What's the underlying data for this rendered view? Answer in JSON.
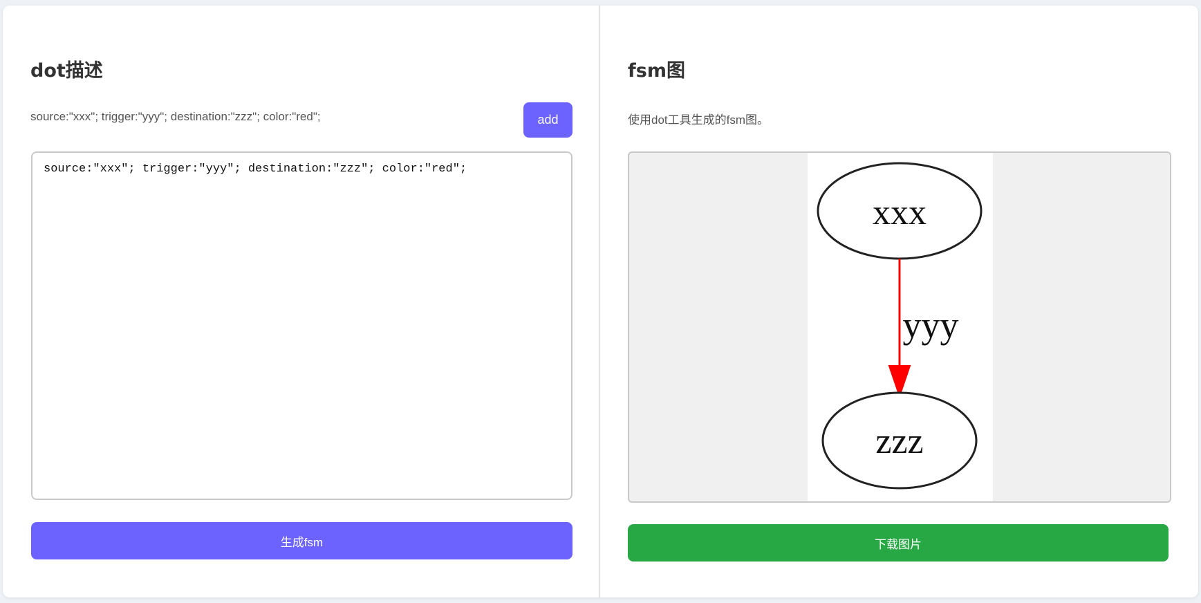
{
  "left": {
    "title": "dot描述",
    "description": "source:\"xxx\"; trigger:\"yyy\"; destination:\"zzz\"; color:\"red\";",
    "add_label": "add",
    "editor_value": "source:\"xxx\"; trigger:\"yyy\"; destination:\"zzz\"; color:\"red\";",
    "generate_label": "生成fsm"
  },
  "right": {
    "title": "fsm图",
    "description": "使用dot工具生成的fsm图。",
    "download_label": "下载图片"
  },
  "graph": {
    "source": "xxx",
    "trigger": "yyy",
    "destination": "zzz",
    "edge_color": "#ff0000"
  },
  "colors": {
    "accent": "#6c63ff",
    "success": "#28a745"
  }
}
